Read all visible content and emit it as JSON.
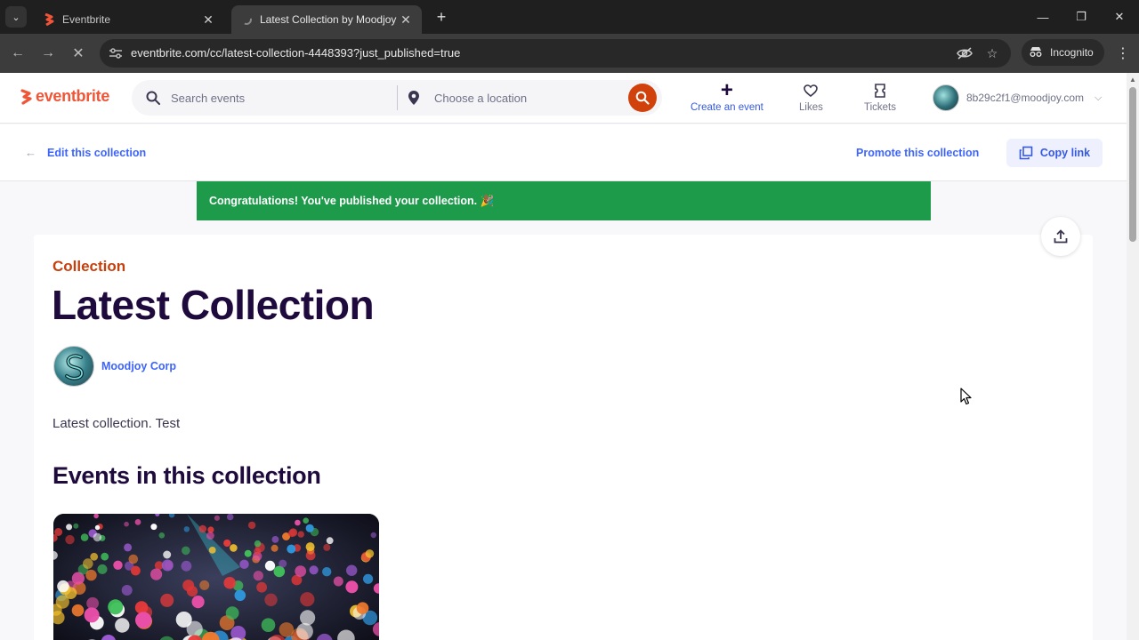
{
  "browser": {
    "tabs": [
      {
        "title": "Eventbrite",
        "active": false
      },
      {
        "title": "Latest Collection by Moodjoy C",
        "active": true
      }
    ],
    "url": "eventbrite.com/cc/latest-collection-4448393?just_published=true",
    "incognito_label": "Incognito"
  },
  "header": {
    "logo_text": "eventbrite",
    "search_placeholder": "Search events",
    "location_placeholder": "Choose a location",
    "create_label": "Create an event",
    "likes_label": "Likes",
    "tickets_label": "Tickets",
    "account_email": "8b29c2f1@moodjoy.com"
  },
  "subheader": {
    "edit_label": "Edit this collection",
    "promote_label": "Promote this collection",
    "copy_label": "Copy link"
  },
  "banner": {
    "text": "Congratulations! You've published your collection. 🎉"
  },
  "collection": {
    "kicker": "Collection",
    "title": "Latest Collection",
    "organizer": "Moodjoy Corp",
    "description": "Latest collection. Test",
    "events_heading": "Events in this collection"
  },
  "colors": {
    "brand": "#f05537",
    "link": "#3d64ff",
    "banner": "#1e9a4b",
    "title": "#1e0a3c",
    "kicker": "#c5400d"
  }
}
